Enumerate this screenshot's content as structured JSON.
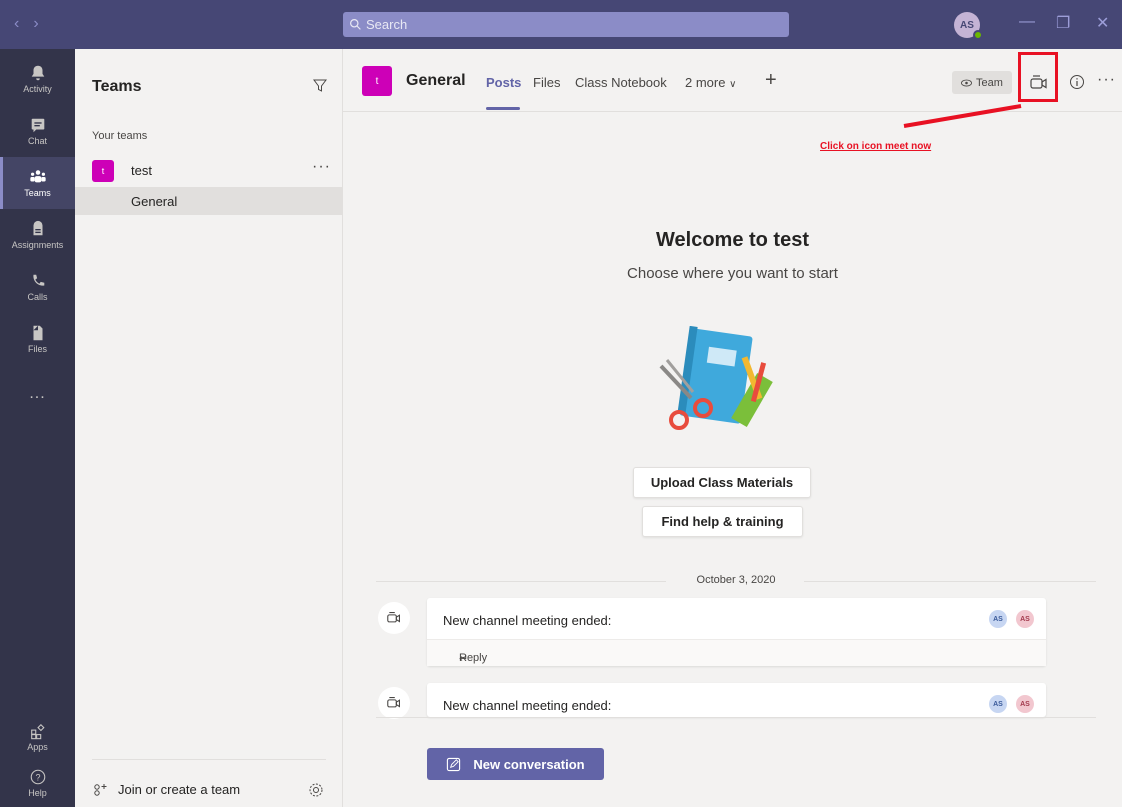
{
  "titlebar": {
    "search_placeholder": "Search",
    "avatar_initials": "AS",
    "back_icon": "chevron-left-icon",
    "forward_icon": "chevron-right-icon",
    "minimize_icon": "minimize-icon",
    "maximize_icon": "restore-icon",
    "close_icon": "close-icon"
  },
  "rail": {
    "items": [
      {
        "label": "Activity",
        "icon": "bell-icon"
      },
      {
        "label": "Chat",
        "icon": "chat-icon"
      },
      {
        "label": "Teams",
        "icon": "teams-icon"
      },
      {
        "label": "Assignments",
        "icon": "assignments-icon"
      },
      {
        "label": "Calls",
        "icon": "phone-icon"
      },
      {
        "label": "Files",
        "icon": "file-icon"
      },
      {
        "label": "...",
        "icon": "more-icon"
      }
    ],
    "bottom": [
      {
        "label": "Apps",
        "icon": "apps-icon"
      },
      {
        "label": "Help",
        "icon": "help-icon"
      }
    ]
  },
  "teams_panel": {
    "title": "Teams",
    "section_label": "Your teams",
    "team": {
      "tile": "t",
      "name": "test",
      "more": "···"
    },
    "channel": {
      "name": "General"
    },
    "join_label": "Join or create a team"
  },
  "channel_header": {
    "tile": "t",
    "title": "General",
    "tabs": [
      "Posts",
      "Files",
      "Class Notebook",
      "2 more"
    ],
    "team_pill": "Team",
    "more": "···"
  },
  "annotation": {
    "text": "Click on icon meet now",
    "color": "#e81123"
  },
  "welcome": {
    "title": "Welcome to test",
    "subtitle": "Choose where you want to start",
    "upload_button": "Upload Class Materials",
    "help_button": "Find help & training"
  },
  "feed": {
    "date": "October 3, 2020",
    "messages": [
      {
        "text": "New channel meeting ended:",
        "avatars": [
          "AS",
          "AS"
        ],
        "reply": "Reply"
      },
      {
        "text": "New channel meeting ended:",
        "avatars": [
          "AS",
          "AS"
        ]
      }
    ],
    "new_conversation": "New conversation"
  },
  "colors": {
    "titlebar": "#464775",
    "rail": "#33344a",
    "accent": "#6264a7",
    "team_tile": "#cd00b7",
    "highlight": "#e81123"
  }
}
